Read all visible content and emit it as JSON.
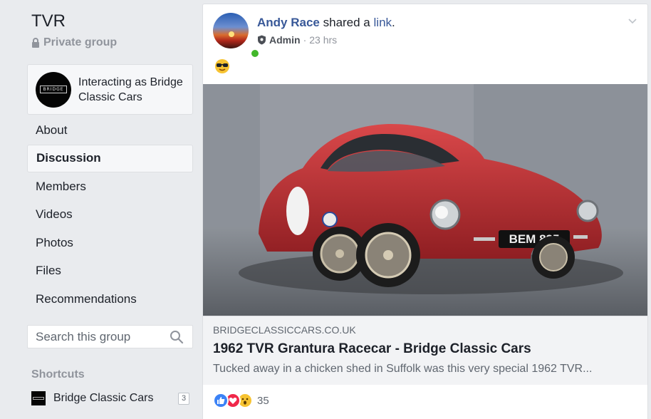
{
  "group": {
    "name": "TVR",
    "privacy": "Private group"
  },
  "acting_as": {
    "text": "Interacting as Bridge Classic Cars",
    "logo_text": "BRIDGE"
  },
  "nav": {
    "items": [
      {
        "label": "About",
        "active": false
      },
      {
        "label": "Discussion",
        "active": true
      },
      {
        "label": "Members",
        "active": false
      },
      {
        "label": "Videos",
        "active": false
      },
      {
        "label": "Photos",
        "active": false
      },
      {
        "label": "Files",
        "active": false
      },
      {
        "label": "Recommendations",
        "active": false
      }
    ]
  },
  "search": {
    "placeholder": "Search this group"
  },
  "shortcuts": {
    "title": "Shortcuts",
    "items": [
      {
        "label": "Bridge Classic Cars",
        "count": "3"
      }
    ]
  },
  "post": {
    "author": "Andy Race",
    "action": "shared a",
    "link_word": "link",
    "role": "Admin",
    "time": "23 hrs",
    "emoji": "😎",
    "link": {
      "domain": "BRIDGECLASSICCARS.CO.UK",
      "title": "1962 TVR Grantura Racecar - Bridge Classic Cars",
      "description": "Tucked away in a chicken shed in Suffolk was this very special 1962 TVR...",
      "plate": "BEM 835"
    },
    "reactions": {
      "count": "35",
      "types": [
        "like",
        "love",
        "wow"
      ]
    }
  },
  "colors": {
    "link_blue": "#385898",
    "online_green": "#42b72a",
    "background": "#e9ebee"
  }
}
